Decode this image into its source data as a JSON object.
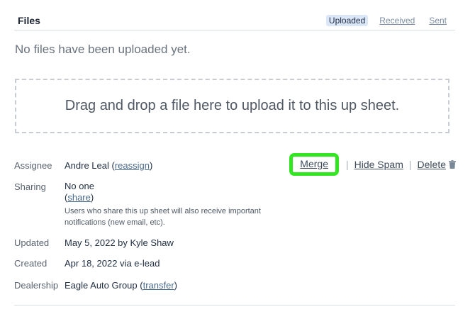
{
  "files": {
    "title": "Files",
    "tabs": [
      {
        "label": "Uploaded",
        "active": true
      },
      {
        "label": "Received",
        "active": false
      },
      {
        "label": "Sent",
        "active": false
      }
    ],
    "empty_message": "No files have been uploaded yet.",
    "dropzone_text": "Drag and drop a file here to upload it to this up sheet."
  },
  "actions": {
    "merge": "Merge",
    "hide_spam": "Hide Spam",
    "delete": "Delete",
    "separator": "|",
    "highlight_color": "#33e622"
  },
  "details": {
    "assignee": {
      "label": "Assignee",
      "value": "Andre Leal",
      "link": "reassign"
    },
    "sharing": {
      "label": "Sharing",
      "value": "No one",
      "link": "share",
      "note_line1": "Users who share this up sheet will also receive important",
      "note_line2": "notifications (new email, etc)."
    },
    "updated": {
      "label": "Updated",
      "value": "May 5, 2022 by Kyle Shaw"
    },
    "created": {
      "label": "Created",
      "value": "Apr 18, 2022 via e-lead"
    },
    "dealership": {
      "label": "Dealership",
      "value": "Eagle Auto Group",
      "link": "transfer"
    }
  }
}
